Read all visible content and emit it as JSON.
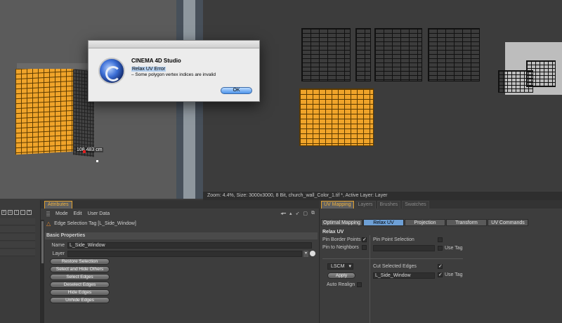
{
  "dialog": {
    "app_name": "CINEMA 4D Studio",
    "heading": "Relax UV Error",
    "message": "– Some polygon vertex indices are invalid",
    "ok_label": "OK",
    "icon": "cinema4d-logo-icon"
  },
  "viewport": {
    "measurement": "108.483 cm",
    "status_line": "Zoom: 4.4%, Size: 3000x3000, 8 Bit, church_wall_Color_1.tif *, Active Layer: Layer"
  },
  "attributes": {
    "tab_label": "Attributes",
    "menu": [
      "Mode",
      "Edit",
      "User Data"
    ],
    "tag_title": "Edge Selection Tag [L_Side_Window]",
    "section_title": "Basic Properties",
    "name_label": "Name",
    "name_value": "L_Side_Window",
    "layer_label": "Layer",
    "layer_value": "",
    "commands": [
      "Restore Selection",
      "Select and Hide Others",
      "Select Edges",
      "Deselect Edges",
      "Hide Edges",
      "Unhide Edges"
    ]
  },
  "uv": {
    "tabs": [
      "UV Mapping",
      "Layers",
      "Brushes",
      "Swatches"
    ],
    "subtabs": [
      "Optimal Mapping",
      "Relax UV",
      "Projection",
      "Transform",
      "UV Commands"
    ],
    "active_subtab": "Relax UV",
    "section_title": "Relax UV",
    "pin_border_points": "Pin Border Points",
    "pin_to_neighbors": "Pin to Neighbors",
    "pin_point_selection": "Pin Point Selection",
    "use_tag_1": "Use Tag",
    "method": "LSCM",
    "apply_label": "Apply",
    "auto_realign": "Auto Realign",
    "cut_selected_edges": "Cut Selected Edges",
    "cut_edges_value": "L_Side_Window",
    "use_tag_2": "Use Tag",
    "check_mark": "✓"
  },
  "colors": {
    "accent_orange": "#f0a42a",
    "tab_highlight": "#e0a030",
    "active_subtab": "#6ea0d6",
    "ok_button": "#4c94ea"
  }
}
